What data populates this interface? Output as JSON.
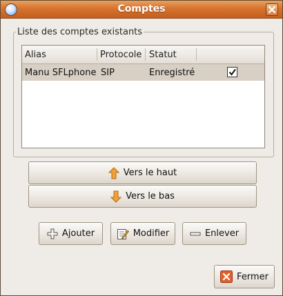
{
  "window": {
    "title": "Comptes"
  },
  "accounts_frame": {
    "label": "Liste des comptes existants"
  },
  "table": {
    "columns": [
      "Alias",
      "Protocole",
      "Statut",
      ""
    ],
    "rows": [
      {
        "alias": "Manu SFLphone",
        "protocol": "SIP",
        "status": "Enregistré",
        "enabled": true
      }
    ]
  },
  "buttons": {
    "move_up": "Vers le haut",
    "move_down": "Vers le bas",
    "add": "Ajouter",
    "edit": "Modifier",
    "remove": "Enlever",
    "close": "Fermer"
  },
  "colors": {
    "titlebar": "#d7732f",
    "window_bg": "#efebe7",
    "selected_row": "#d8d0c4",
    "arrow_icon": "#f0a13a",
    "close_icon": "#e2612b"
  }
}
